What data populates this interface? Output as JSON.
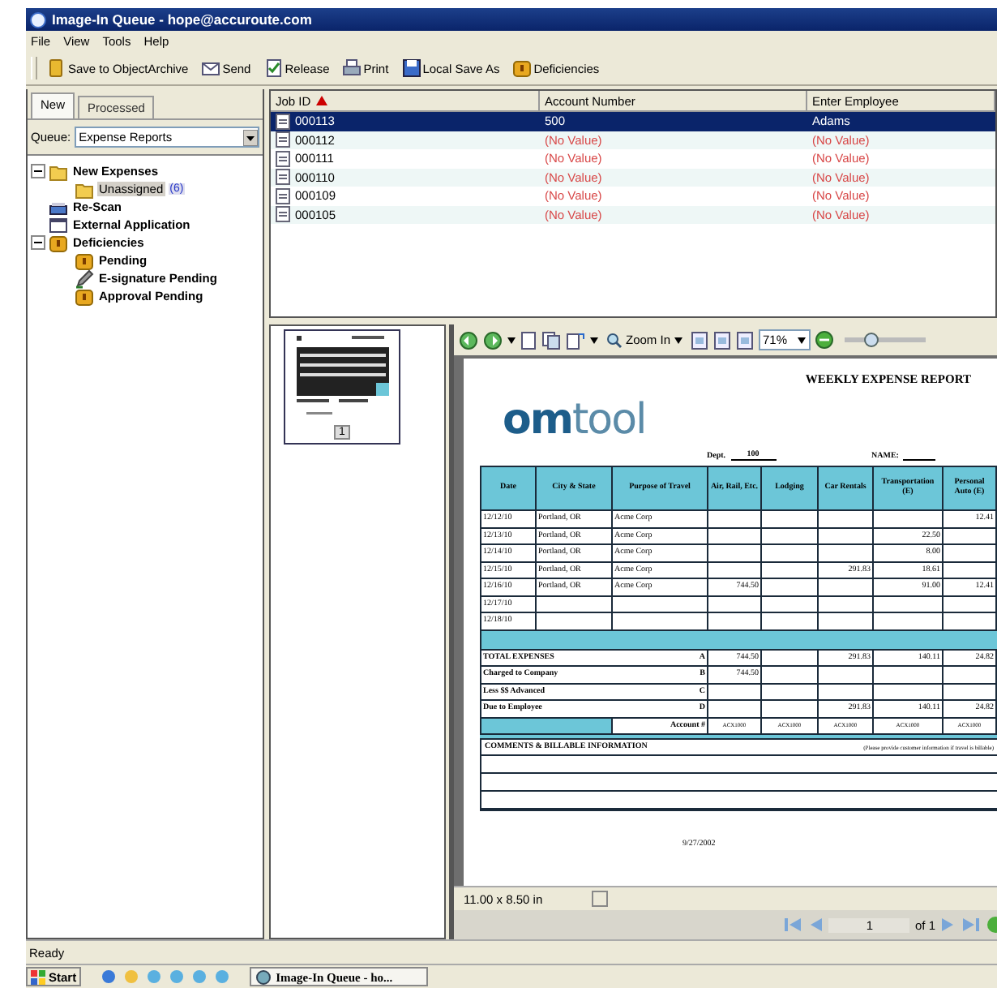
{
  "window": {
    "title": "Image-In Queue - hope@accuroute.com"
  },
  "menu": [
    "File",
    "View",
    "Tools",
    "Help"
  ],
  "toolbar": [
    {
      "label": "Save to ObjectArchive",
      "kind": "archive"
    },
    {
      "label": "Send",
      "kind": "send"
    },
    {
      "label": "Release",
      "kind": "release"
    },
    {
      "label": "Print",
      "kind": "print"
    },
    {
      "label": "Local Save As",
      "kind": "save"
    },
    {
      "label": "Deficiencies",
      "kind": "deficiency"
    }
  ],
  "tabs": [
    {
      "label": "New",
      "selected": true
    },
    {
      "label": "Processed",
      "selected": false
    }
  ],
  "queue": {
    "label": "Queue:",
    "value": "Expense Reports"
  },
  "tree": [
    {
      "label": "New Expenses",
      "kind": "folder",
      "bold": true,
      "expanded": true,
      "selected": false,
      "children": [
        {
          "label": "Unassigned",
          "count": "(6)",
          "kind": "folder",
          "bold": false,
          "selected": true
        }
      ]
    },
    {
      "label": "Re-Scan",
      "kind": "scan",
      "bold": true,
      "selected": false
    },
    {
      "label": "External Application",
      "kind": "app",
      "bold": true,
      "selected": false
    },
    {
      "label": "Deficiencies",
      "kind": "deficiency",
      "bold": true,
      "expanded": true,
      "selected": false,
      "children": [
        {
          "label": "Pending",
          "kind": "deficiency",
          "bold": true,
          "selected": false
        },
        {
          "label": "E-signature Pending",
          "kind": "pen",
          "bold": true,
          "selected": false
        },
        {
          "label": "Approval Pending",
          "kind": "deficiency",
          "bold": true,
          "selected": false
        }
      ]
    }
  ],
  "jobs": {
    "columns": [
      {
        "label": "Job ID",
        "sorted": true
      },
      {
        "label": "Account Number",
        "sorted": false
      },
      {
        "label": "Enter Employee",
        "sorted": false
      }
    ],
    "rows": [
      {
        "job_id": "000113",
        "account": "500",
        "employee": "Adams",
        "unset": false,
        "selected": true
      },
      {
        "job_id": "000112",
        "account": "(No Value)",
        "employee": "(No Value)",
        "unset": true,
        "selected": false
      },
      {
        "job_id": "000111",
        "account": "(No Value)",
        "employee": "(No Value)",
        "unset": true,
        "selected": false
      },
      {
        "job_id": "000110",
        "account": "(No Value)",
        "employee": "(No Value)",
        "unset": true,
        "selected": false
      },
      {
        "job_id": "000109",
        "account": "(No Value)",
        "employee": "(No Value)",
        "unset": true,
        "selected": false
      },
      {
        "job_id": "000105",
        "account": "(No Value)",
        "employee": "(No Value)",
        "unset": true,
        "selected": false
      }
    ]
  },
  "thumbnails": [
    {
      "page": "1",
      "selected": true
    }
  ],
  "viewer": {
    "zoom_button": "Zoom In",
    "zoom": "71%",
    "zoom_slider": {
      "level": 0.25
    },
    "page_size": "11.00 x 8.50 in",
    "page": "1",
    "page_count": "of 1"
  },
  "document": {
    "title": "WEEKLY EXPENSE REPORT",
    "logo": "**om**tool",
    "dept_label": "Dept.",
    "dept": "100",
    "name_label": "NAME:",
    "columns": [
      "Date",
      "City & State",
      "Purpose of Travel",
      "Air, Rail, Etc.",
      "Lodging",
      "Car Rentals",
      "Transportation (E)",
      "Personal Auto (E)"
    ],
    "rows": [
      {
        "date": "12/12/10",
        "city": "Portland, OR",
        "purpose": "Acme Corp",
        "personal_auto": "12.41"
      },
      {
        "date": "12/13/10",
        "city": "Portland, OR",
        "purpose": "Acme Corp",
        "transportation": "22.50"
      },
      {
        "date": "12/14/10",
        "city": "Portland, OR",
        "purpose": "Acme Corp",
        "transportation": "8.00"
      },
      {
        "date": "12/15/10",
        "city": "Portland, OR",
        "purpose": "Acme Corp",
        "car_rentals": "291.83",
        "transportation": "18.61"
      },
      {
        "date": "12/16/10",
        "city": "Portland, OR",
        "purpose": "Acme Corp",
        "air_rail": "744.50",
        "transportation": "91.00",
        "personal_auto": "12.41"
      },
      {
        "date": "12/17/10"
      },
      {
        "date": "12/18/10"
      }
    ],
    "totals": [
      {
        "label": "TOTAL EXPENSES",
        "letter": "A",
        "air_rail": "744.50",
        "car_rentals": "291.83",
        "transportation": "140.11",
        "personal_auto": "24.82"
      },
      {
        "label": "Charged to Company",
        "letter": "B",
        "air_rail": "744.50"
      },
      {
        "label": "Less $$ Advanced",
        "letter": "C"
      },
      {
        "label": "Due to Employee",
        "letter": "D",
        "car_rentals": "291.83",
        "transportation": "140.11",
        "personal_auto": "24.82"
      }
    ],
    "account": {
      "label": "Account #",
      "air_rail": "ACX1000",
      "lodging": "ACX1000",
      "car_rentals": "ACX1000",
      "transportation": "ACX1000",
      "personal_auto": "ACX1000"
    },
    "comments": {
      "label": "COMMENTS & BILLABLE INFORMATION",
      "note": "(Please provide customer information if travel is billable)"
    },
    "date": "9/27/2002"
  },
  "status_bar": "Ready",
  "taskbar": {
    "start": "Start",
    "tasks": [
      {
        "label": "Image-In Queue - ho...",
        "selected": true
      }
    ]
  }
}
